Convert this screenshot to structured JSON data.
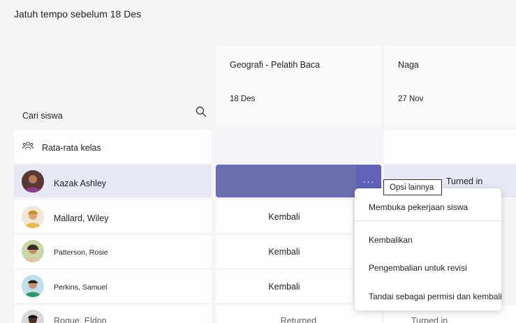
{
  "due_label": "Jatuh tempo sebelum 18 Des",
  "search": {
    "label": "Cari siswa",
    "icon": "search-icon"
  },
  "assignments": [
    {
      "title": "Geografi - Pelatih Baca",
      "date": "18 Des"
    },
    {
      "title": "Naga",
      "date": "27 Nov"
    }
  ],
  "class_average": {
    "label": "Rata-rata kelas",
    "icon": "people-icon"
  },
  "students": [
    {
      "name": "Kazak Ashley",
      "col_b": "Turned in"
    },
    {
      "name": "Mallard, Wiley",
      "col_a": "Kembali"
    },
    {
      "name": "Patterson, Rosie",
      "col_a": "Kembali"
    },
    {
      "name": "Perkins, Samuel",
      "col_a": "Kembali"
    },
    {
      "name": "Rogue, Eldon",
      "col_a": "Returned",
      "col_b": "Turned in"
    }
  ],
  "tooltip": "Opsi lainnya",
  "more_button": "···",
  "context_menu": [
    "Membuka pekerjaan siswa",
    "Kembalikan",
    "Pengembalian untuk revisi",
    "Tandai sebagai permisi dan kembali"
  ],
  "colors": {
    "accent": "#6264a7",
    "selected_row": "#e6e8f5",
    "background": "#f5f5f5"
  }
}
